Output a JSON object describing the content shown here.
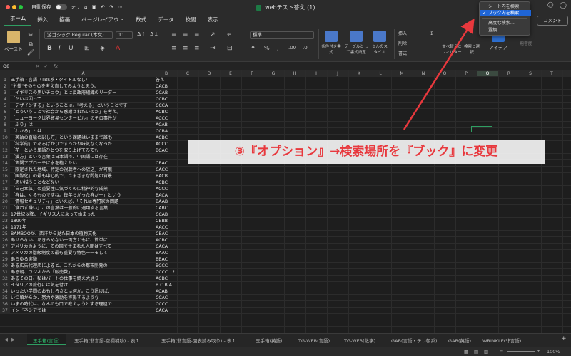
{
  "titlebar": {
    "autosave_label": "自動保存",
    "autosave_state": "オフ",
    "file_title": "webテスト答え (1)"
  },
  "menubar": {
    "tabs": [
      "ホーム",
      "挿入",
      "描画",
      "ページレイアウト",
      "数式",
      "データ",
      "校閲",
      "表示"
    ],
    "comment_button": "コメント"
  },
  "ribbon": {
    "paste": "ペースト",
    "font_name": "游ゴシック Regular (本文)",
    "font_size": "11",
    "number_format": "標準",
    "conditional_format": "条件付き書式",
    "table_format": "テーブルとして書式設定",
    "cell_style": "セルのスタイル",
    "insert": "挿入",
    "delete": "削除",
    "format": "書式",
    "sort_filter": "並べ替えとフィルター",
    "find_select": "検索と選択",
    "ideas": "アイデア",
    "sensitivity": "秘密度"
  },
  "formula_bar": {
    "name_box": "Q8",
    "fx": "fx"
  },
  "columns": [
    "A",
    "B",
    "C",
    "D",
    "E",
    "F",
    "G",
    "H",
    "I",
    "J",
    "K",
    "L",
    "M",
    "N",
    "O",
    "P",
    "Q",
    "R",
    "S",
    "T"
  ],
  "rows": [
    {
      "n": "1",
      "a": "玉手箱・言語（TBS系・タイトルなし）",
      "b": "答え"
    },
    {
      "n": "2",
      "a": "\"労働\"そのものを考え直してみようと思う。",
      "b": "CACB"
    },
    {
      "n": "3",
      "a": "「イギリスの黒いチョウ」とは反政府組織のリーダー",
      "b": "CCAB"
    },
    {
      "n": "4",
      "a": "「だいぶ因って",
      "b": "CCBC"
    },
    {
      "n": "5",
      "a": "「デザインする」ということは、「考える」ということです",
      "b": "CCCA"
    },
    {
      "n": "6",
      "a": "「どういうことで社会から感謝されたいのか」を考え。",
      "b": "ACBC"
    },
    {
      "n": "7",
      "a": "「ニューヨーク世界貿易センタービル」のテロ事件が",
      "b": "ACCC"
    },
    {
      "n": "8",
      "a": "「ふり」は",
      "b": "ACAB"
    },
    {
      "n": "9",
      "a": "「わかる」とは",
      "b": "CCBA"
    },
    {
      "n": "10",
      "a": "「英語の直喩の訳し方」という課題はいままで誰も",
      "b": "ACBC"
    },
    {
      "n": "11",
      "a": "「科学的」であるばかりですっかり味気なくなった",
      "b": "ACCC"
    },
    {
      "n": "12",
      "a": "「花」という単語ひとつを取り上げてみても",
      "b": "BCAC"
    },
    {
      "n": "13",
      "a": "「漢方」という言葉は日本語で、中国語には存在",
      "b": ""
    },
    {
      "n": "14",
      "a": "「玄関アプローチに水を植えたい",
      "b": "CBAC"
    },
    {
      "n": "15",
      "a": "「限定された地域、特定の視聴者への放送」が可能",
      "b": "CACC"
    },
    {
      "n": "16",
      "a": "「国際化」の最も中心的で、さまざまな問題の背景",
      "b": "BACB"
    },
    {
      "n": "17",
      "a": "「思い描うことなどない",
      "b": "ACBC"
    },
    {
      "n": "18",
      "a": "「自己本位」の重要性に気づくのに精神的な成熟",
      "b": "ACCC"
    },
    {
      "n": "19",
      "a": "「春は、くるものですね。毎年ちがった春が一」という",
      "b": "BACA"
    },
    {
      "n": "20",
      "a": "「情報セキュリティ」といえば、「それは専門家の問題",
      "b": "BAAB"
    },
    {
      "n": "21",
      "a": "「食わず嫌い」この言葉は一般的に適用する言葉",
      "b": "CABC"
    },
    {
      "n": "22",
      "a": "17世紀以降、イギリス人によって始まった",
      "b": "CCAB"
    },
    {
      "n": "23",
      "a": "1890年",
      "b": "CBBB"
    },
    {
      "n": "24",
      "a": "1971年",
      "b": "AACC"
    },
    {
      "n": "25",
      "a": "BAMBOOが、西洋から見た日本の植物文化",
      "b": "CBAC"
    },
    {
      "n": "26",
      "a": "あせらない、あきらめない一両方ともに、簡単に",
      "b": "ACBC"
    },
    {
      "n": "27",
      "a": "アメリカのように、その国で生まれた人間はすべて",
      "b": "CACA"
    },
    {
      "n": "28",
      "a": "アメリカの階級制度の最も重要な特色一一そして",
      "b": "BAAC"
    },
    {
      "n": "29",
      "a": "あらゆる実験",
      "b": "BBAC"
    },
    {
      "n": "30",
      "a": "ある広告代理店によると、これからの都市開発の",
      "b": "BCCC"
    },
    {
      "n": "31",
      "a": "ある朝、ラジオから「販売数」",
      "b": "CCCC　?"
    },
    {
      "n": "32",
      "a": "あるその日、私はパートの仕事を終え大通り",
      "b": "ACBC"
    },
    {
      "n": "33",
      "a": "イタリアの旅行には気を付け",
      "b": "B C B A"
    },
    {
      "n": "34",
      "a": "いったい学問のおもしろさとは何か。こう訊けば、",
      "b": "ACAB"
    },
    {
      "n": "35",
      "a": "いつ頃からか、努力や激励を称揚するような",
      "b": "CCAC"
    },
    {
      "n": "36",
      "a": "いまの時代は、なんでも口で教えようとする理屈で",
      "b": "CCCC"
    },
    {
      "n": "37",
      "a": "インドネシアでは",
      "b": "CACA"
    }
  ],
  "sheet_tabs": [
    "玉手箱(言語)",
    "玉手箱(非言語-空欄補助) - 表１",
    "玉手箱(非言語-図表読み取り) - 表１",
    "玉手箱(英語)",
    "TG-WEB(言語)",
    "TG-WEB(数学)",
    "GAB(言語・テレ朝系)",
    "GAB(英語)",
    "WRINKLE(非言語)"
  ],
  "search_dropdown": {
    "items": [
      "シート内を検索",
      "ブック内を検索",
      "高度な検索...",
      "置換..."
    ],
    "selected_index": 1
  },
  "annotation": "③『オプション』→検索場所を『ブック』に変更",
  "status": {
    "zoom": "100%"
  },
  "colors": {
    "accent_green": "#2f9e62",
    "annotation_red": "#e8383d",
    "dropdown_highlight": "#1f65d6"
  }
}
